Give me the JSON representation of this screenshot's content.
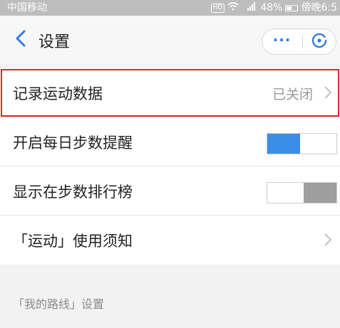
{
  "status_bar": {
    "carrier": "中国移动",
    "hd": "HD",
    "signal": "4G",
    "battery": "48%",
    "time": "傍晚6:5"
  },
  "nav": {
    "title": "设置",
    "more_label": "···"
  },
  "settings": [
    {
      "label": "记录运动数据",
      "value": "已关闭",
      "type": "link",
      "highlighted": true
    },
    {
      "label": "开启每日步数提醒",
      "type": "toggle",
      "on": true
    },
    {
      "label": "显示在步数排行榜",
      "type": "toggle",
      "on": false
    },
    {
      "label": "「运动」使用须知",
      "type": "link"
    }
  ],
  "section": {
    "title": "「我的路线」设置"
  },
  "colors": {
    "accent": "#3b8ee8",
    "highlight_border": "#e0242a",
    "toggle_off": "#9e9e9e"
  }
}
